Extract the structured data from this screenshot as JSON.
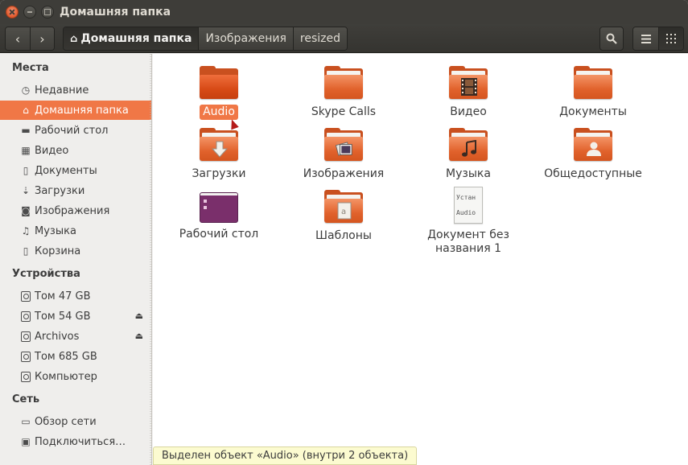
{
  "window": {
    "title": "Домашняя папка"
  },
  "toolbar": {
    "crumbs": [
      "Домашняя папка",
      "Изображения",
      "resized"
    ]
  },
  "sidebar": {
    "places_title": "Места",
    "places": [
      {
        "label": "Недавние",
        "icon": "clock-icon"
      },
      {
        "label": "Домашняя папка",
        "icon": "home-icon",
        "selected": true
      },
      {
        "label": "Рабочий стол",
        "icon": "folder-icon"
      },
      {
        "label": "Видео",
        "icon": "film-icon"
      },
      {
        "label": "Документы",
        "icon": "document-icon"
      },
      {
        "label": "Загрузки",
        "icon": "download-icon"
      },
      {
        "label": "Изображения",
        "icon": "camera-icon"
      },
      {
        "label": "Музыка",
        "icon": "music-icon"
      },
      {
        "label": "Корзина",
        "icon": "trash-icon"
      }
    ],
    "devices_title": "Устройства",
    "devices": [
      {
        "label": "Том 47 GB",
        "eject": false
      },
      {
        "label": "Том 54 GB",
        "eject": true
      },
      {
        "label": "Archivos",
        "eject": true
      },
      {
        "label": "Том 685 GB",
        "eject": false
      },
      {
        "label": "Компьютер",
        "eject": false
      }
    ],
    "network_title": "Сеть",
    "network": [
      {
        "label": "Обзор сети",
        "icon": "network-icon"
      },
      {
        "label": "Подключиться…",
        "icon": "server-icon"
      }
    ]
  },
  "files": [
    {
      "name": "Audio",
      "type": "folder",
      "selected": true
    },
    {
      "name": "Skype Calls",
      "type": "folder"
    },
    {
      "name": "Видео",
      "type": "folder-video"
    },
    {
      "name": "Документы",
      "type": "folder-documents"
    },
    {
      "name": "Загрузки",
      "type": "folder-downloads"
    },
    {
      "name": "Изображения",
      "type": "folder-pictures"
    },
    {
      "name": "Музыка",
      "type": "folder-music"
    },
    {
      "name": "Общедоступные",
      "type": "folder-public"
    },
    {
      "name": "Рабочий стол",
      "type": "desktop"
    },
    {
      "name": "Шаблоны",
      "type": "folder-templates"
    },
    {
      "name": "Документ без названия 1",
      "type": "text-document",
      "preview_lines": [
        "Устан",
        "Audio"
      ]
    }
  ],
  "status": "Выделен объект «Audio» (внутри 2 объекта)",
  "colors": {
    "accent": "#f07746",
    "titlebar": "#3e3d39",
    "folder": "#e1622c"
  }
}
